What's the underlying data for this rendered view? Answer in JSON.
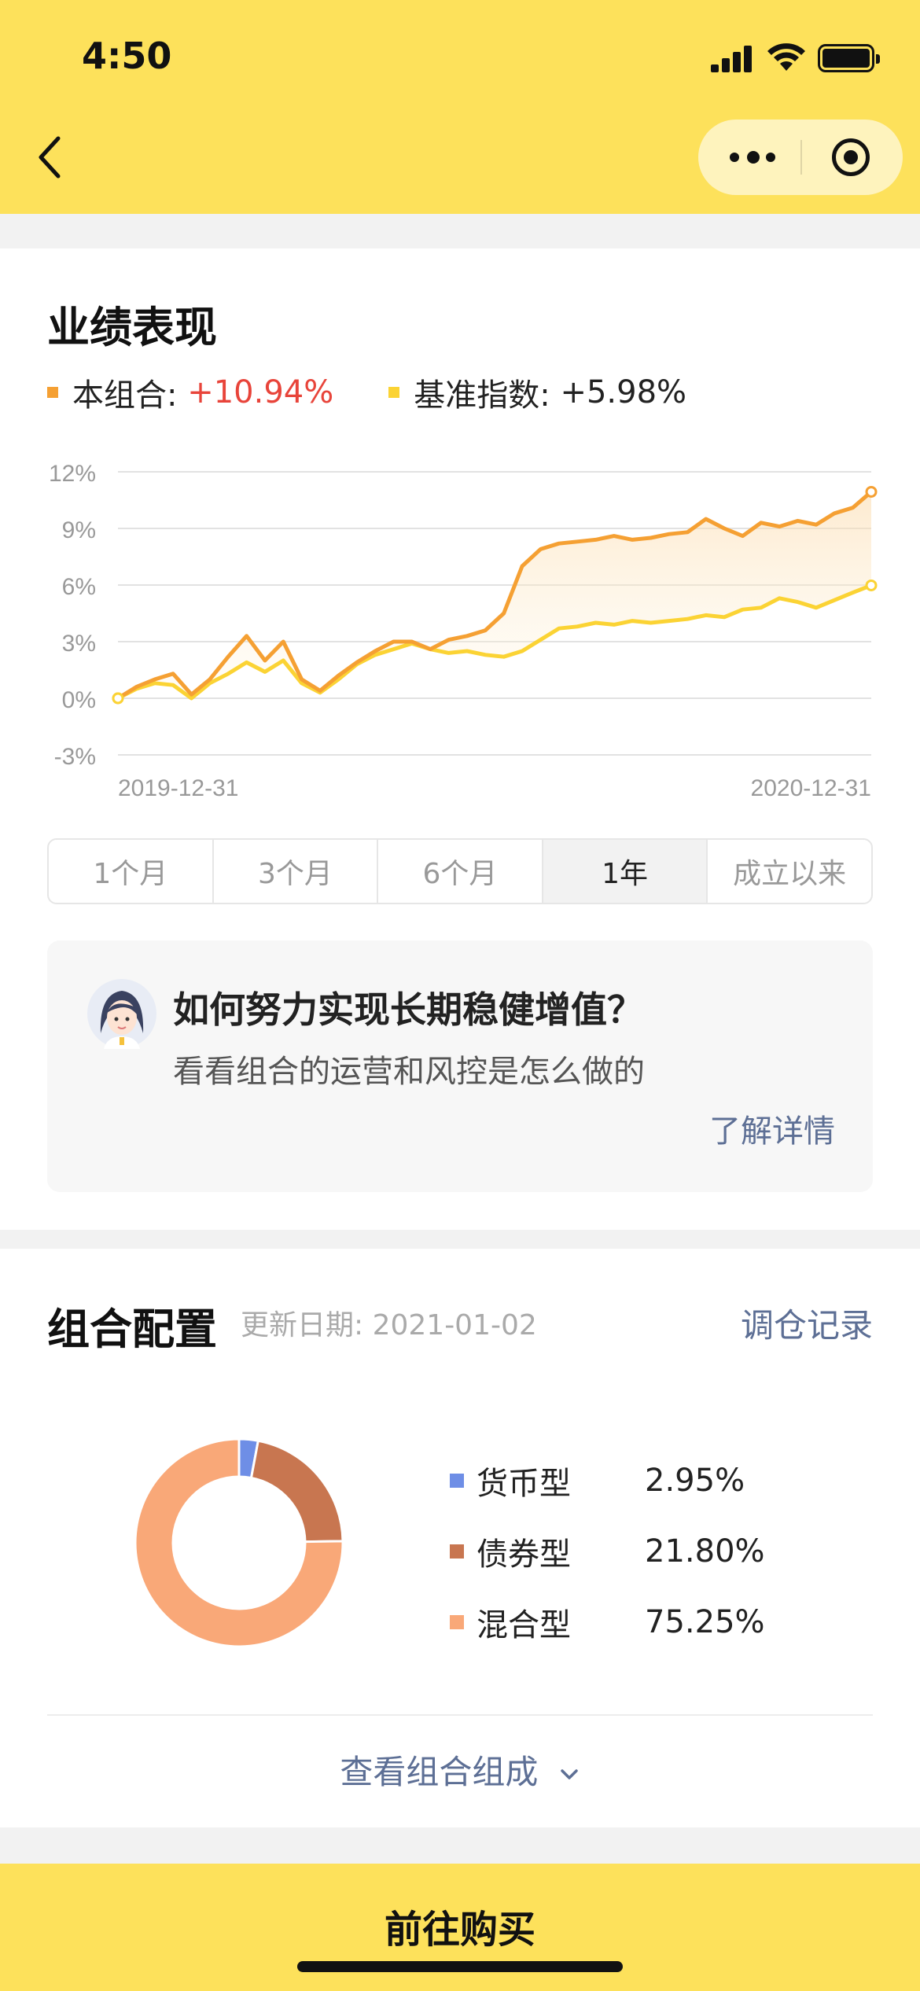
{
  "status_bar": {
    "time": "4:50"
  },
  "performance": {
    "title": "业绩表现",
    "legend": [
      {
        "label": "本组合:",
        "value": "+10.94%",
        "color": "#f5a033",
        "value_color": "#e8443a"
      },
      {
        "label": "基准指数:",
        "value": "+5.98%",
        "color": "#fbd334",
        "value_color": "#222222"
      }
    ],
    "tabs": [
      "1个月",
      "3个月",
      "6个月",
      "1年",
      "成立以来"
    ],
    "active_tab": "1年"
  },
  "chart_data": {
    "type": "line",
    "x_start": "2019-12-31",
    "x_end": "2020-12-31",
    "yticks": [
      "12%",
      "9%",
      "6%",
      "3%",
      "0%",
      "-3%"
    ],
    "ylim": [
      -3,
      12
    ],
    "y_unit": "%",
    "series": [
      {
        "name": "本组合",
        "color": "#f5a033",
        "values": [
          0,
          0.6,
          1.0,
          1.3,
          0.2,
          1.0,
          2.2,
          3.3,
          2.0,
          3.0,
          1.0,
          0.4,
          1.2,
          1.9,
          2.5,
          3.0,
          3.0,
          2.6,
          3.1,
          3.3,
          3.6,
          4.5,
          7.0,
          7.9,
          8.2,
          8.3,
          8.4,
          8.6,
          8.4,
          8.5,
          8.7,
          8.8,
          9.5,
          9.0,
          8.6,
          9.3,
          9.1,
          9.4,
          9.2,
          9.8,
          10.1,
          10.94
        ]
      },
      {
        "name": "基准指数",
        "color": "#fbd334",
        "values": [
          0,
          0.5,
          0.8,
          0.7,
          0.0,
          0.8,
          1.3,
          1.9,
          1.4,
          2.0,
          0.8,
          0.3,
          1.0,
          1.8,
          2.3,
          2.6,
          2.9,
          2.6,
          2.4,
          2.5,
          2.3,
          2.2,
          2.5,
          3.1,
          3.7,
          3.8,
          4.0,
          3.9,
          4.1,
          4.0,
          4.1,
          4.2,
          4.4,
          4.3,
          4.7,
          4.8,
          5.3,
          5.1,
          4.8,
          5.2,
          5.6,
          5.98
        ]
      }
    ],
    "grid": true
  },
  "promo": {
    "title": "如何努力实现长期稳健增值？",
    "subtitle": "看看组合的运营和风控是怎么做的",
    "link": "了解详情"
  },
  "allocation": {
    "title": "组合配置",
    "date_label": "更新日期: 2021-01-02",
    "history_link": "调仓记录",
    "items": [
      {
        "name": "货币型",
        "value": "2.95%",
        "percent": 2.95,
        "color": "#6e8ee6"
      },
      {
        "name": "债券型",
        "value": "21.80%",
        "percent": 21.8,
        "color": "#c87650"
      },
      {
        "name": "混合型",
        "value": "75.25%",
        "percent": 75.25,
        "color": "#f9a878"
      }
    ],
    "more_link": "查看组合组成"
  },
  "buy_button": "前往购买"
}
